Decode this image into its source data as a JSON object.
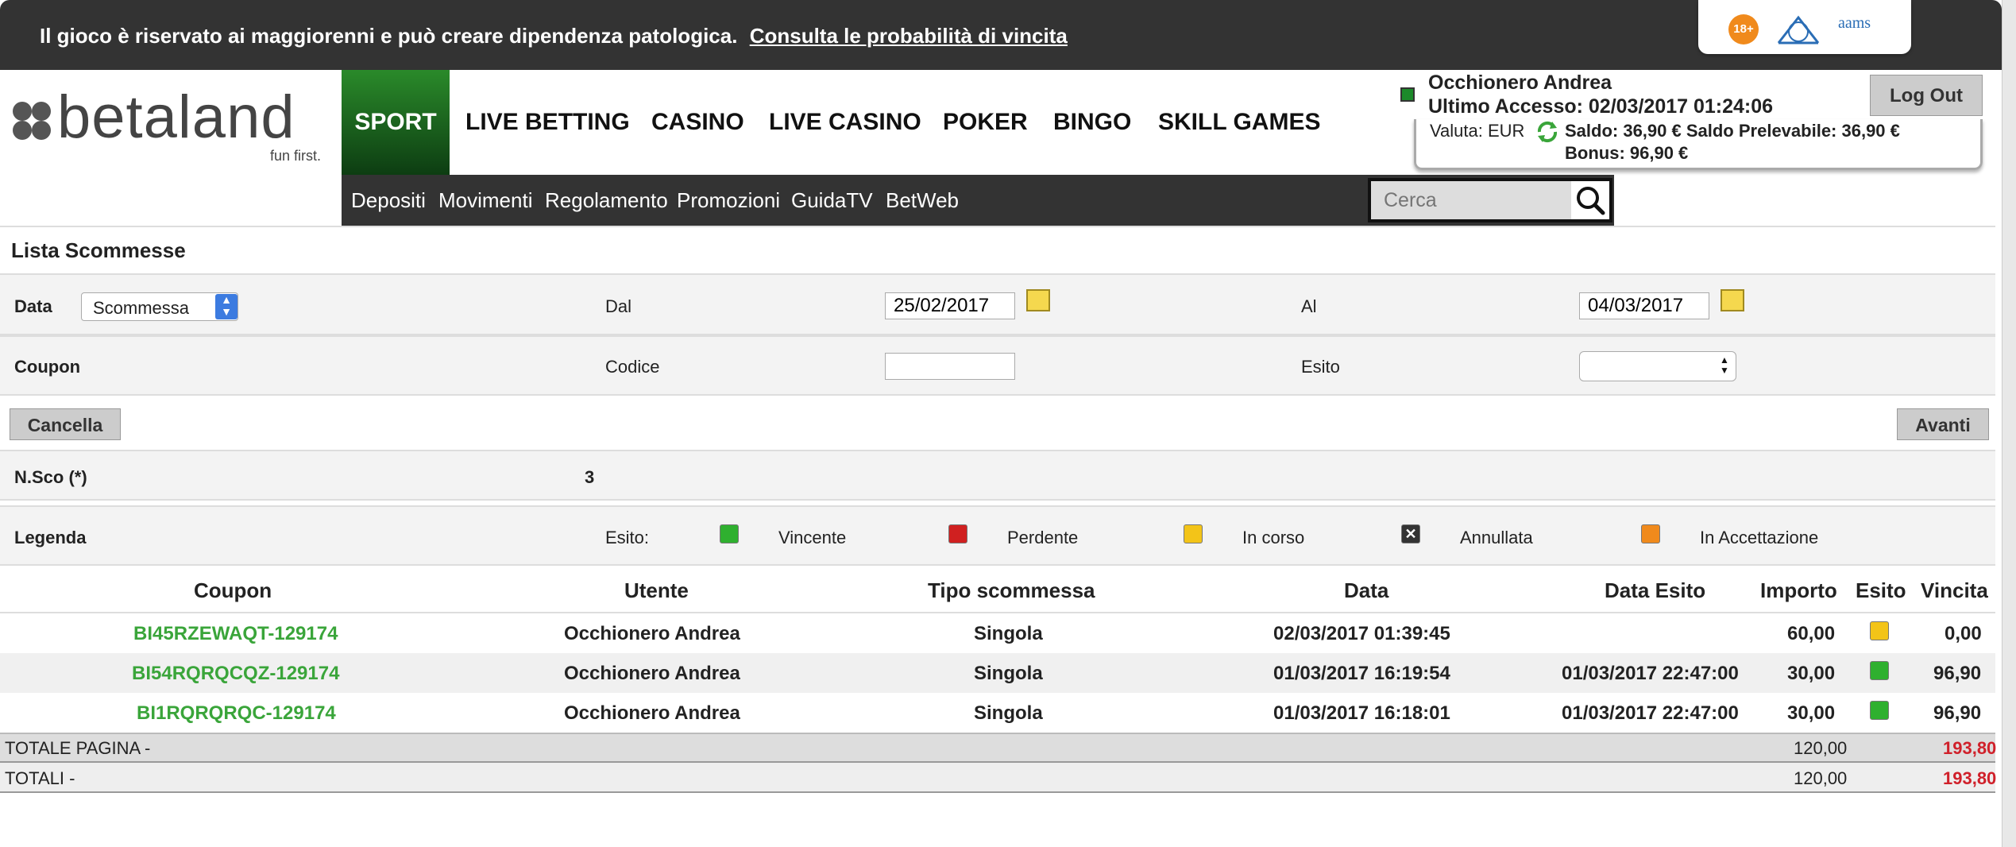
{
  "banner": {
    "text": "Il gioco è riservato ai maggiorenni e può creare dipendenza patologica.",
    "link": "Consulta le probabilità di vincita",
    "badge_18": "18+",
    "aams": "aams"
  },
  "logo": {
    "brand": "betaland",
    "tagline": "fun first."
  },
  "nav": {
    "items": [
      "SPORT",
      "LIVE BETTING",
      "CASINO",
      "LIVE CASINO",
      "POKER",
      "BINGO",
      "SKILL GAMES"
    ]
  },
  "subnav": {
    "items": [
      "Depositi",
      "Movimenti",
      "Regolamento",
      "Promozioni",
      "GuidaTV",
      "BetWeb"
    ]
  },
  "search": {
    "placeholder": "Cerca"
  },
  "user": {
    "name": "Occhionero Andrea",
    "last_access": "Ultimo Accesso: 02/03/2017 01:24:06",
    "logout": "Log Out",
    "valuta": "Valuta: EUR",
    "saldo": "Saldo: 36,90 € Saldo Prelevabile: 36,90 €",
    "bonus": "Bonus: 96,90 €"
  },
  "page": {
    "title": "Lista Scommesse"
  },
  "filters": {
    "data_label": "Data",
    "data_select": "Scommessa",
    "dal_label": "Dal",
    "dal_value": "25/02/2017",
    "al_label": "Al",
    "al_value": "04/03/2017",
    "coupon_label": "Coupon",
    "codice_label": "Codice",
    "codice_value": "",
    "esito_label": "Esito",
    "esito_value": "",
    "cancel": "Cancella",
    "next": "Avanti"
  },
  "nsco": {
    "label": "N.Sco (*)",
    "value": "3"
  },
  "legend": {
    "label": "Legenda",
    "esito": "Esito:",
    "items": [
      {
        "label": "Vincente",
        "color": "#2fb02f"
      },
      {
        "label": "Perdente",
        "color": "#d02020"
      },
      {
        "label": "In corso",
        "color": "#f3c418"
      },
      {
        "label": "Annullata",
        "color": "#333333"
      },
      {
        "label": "In Accettazione",
        "color": "#f08a1c"
      }
    ]
  },
  "table": {
    "headers": [
      "Coupon",
      "Utente",
      "Tipo scommessa",
      "Data",
      "Data Esito",
      "Importo",
      "Esito",
      "Vincita"
    ],
    "rows": [
      {
        "coupon": "BI45RZEWAQT-129174",
        "utente": "Occhionero Andrea",
        "tipo": "Singola",
        "data": "02/03/2017 01:39:45",
        "data_esito": "",
        "importo": "60,00",
        "esito_color": "#f3c418",
        "vincita": "0,00"
      },
      {
        "coupon": "BI54RQRQCQZ-129174",
        "utente": "Occhionero Andrea",
        "tipo": "Singola",
        "data": "01/03/2017 16:19:54",
        "data_esito": "01/03/2017 22:47:00",
        "importo": "30,00",
        "esito_color": "#2fb02f",
        "vincita": "96,90"
      },
      {
        "coupon": "BI1RQRQRQC-129174",
        "utente": "Occhionero Andrea",
        "tipo": "Singola",
        "data": "01/03/2017 16:18:01",
        "data_esito": "01/03/2017 22:47:00",
        "importo": "30,00",
        "esito_color": "#2fb02f",
        "vincita": "96,90"
      }
    ],
    "totale_pagina": {
      "label": "TOTALE PAGINA -",
      "importo": "120,00",
      "vincita": "193,80"
    },
    "totali": {
      "label": "TOTALI -",
      "importo": "120,00",
      "vincita": "193,80"
    }
  }
}
